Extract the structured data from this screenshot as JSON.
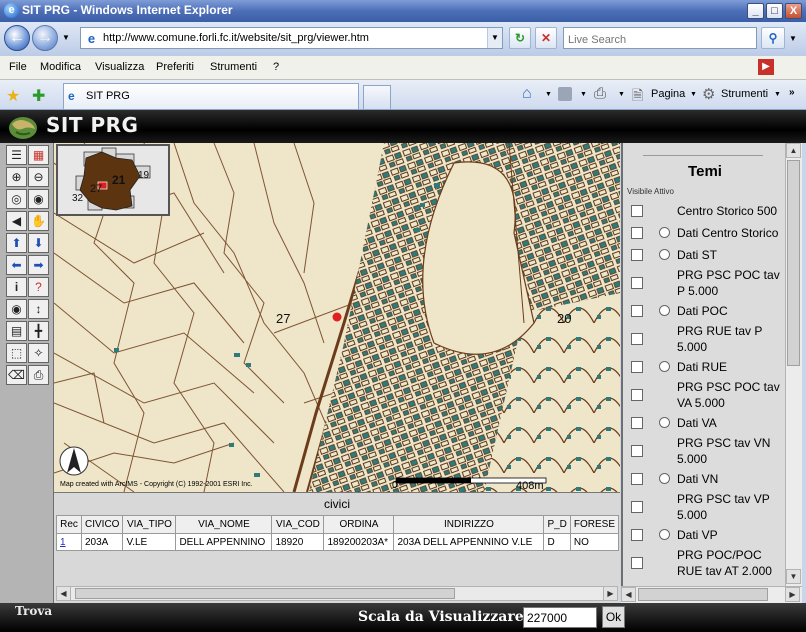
{
  "window": {
    "title": "SIT PRG - Windows Internet Explorer",
    "minimize": "_",
    "maximize": "□",
    "close": "X"
  },
  "address": {
    "url": "http://www.comune.forli.fc.it/website/sit_prg/viewer.htm",
    "search_placeholder": "Live Search"
  },
  "menu": [
    "File",
    "Modifica",
    "Visualizza",
    "Preferiti",
    "Strumenti",
    "?"
  ],
  "tab": {
    "label": "SIT PRG"
  },
  "commandbar": {
    "page": "Pagina",
    "tools": "Strumenti"
  },
  "app": {
    "title": "SIT PRG"
  },
  "map": {
    "overview_labels": [
      "21",
      "19",
      "27",
      "32"
    ],
    "labels": [
      "27",
      "20"
    ],
    "copyright": "Map created with ArcIMS - Copyright (C) 1992-2001 ESRI Inc.",
    "scalebar": {
      "start": "0",
      "end": "408m"
    }
  },
  "grid": {
    "title": "civici",
    "columns": [
      "Rec",
      "CIVICO",
      "VIA_TIPO",
      "VIA_NOME",
      "VIA_COD",
      "ORDINA",
      "INDIRIZZO",
      "P_D",
      "FORESE"
    ],
    "rows": [
      [
        "1",
        "203A",
        "V.LE",
        "DELL APPENNINO",
        "18920",
        "189200203A*",
        "203A DELL APPENNINO V.LE",
        "D",
        "NO"
      ]
    ]
  },
  "panel": {
    "title": "Temi",
    "header": "Visibile Attivo",
    "layers": [
      {
        "name": "Centro Storico 500",
        "radio": false
      },
      {
        "name": "Dati Centro Storico",
        "radio": true
      },
      {
        "name": "Dati ST",
        "radio": true
      },
      {
        "name": "PRG PSC POC tav P 5.000",
        "radio": false
      },
      {
        "name": "Dati POC",
        "radio": true
      },
      {
        "name": "PRG RUE tav P 5.000",
        "radio": false
      },
      {
        "name": "Dati RUE",
        "radio": true
      },
      {
        "name": "PRG PSC POC tav VA 5.000",
        "radio": false
      },
      {
        "name": "Dati VA",
        "radio": true
      },
      {
        "name": "PRG PSC tav VN 5.000",
        "radio": false
      },
      {
        "name": "Dati VN",
        "radio": true
      },
      {
        "name": "PRG PSC tav VP 5.000",
        "radio": false
      },
      {
        "name": "Dati VP",
        "radio": true
      },
      {
        "name": "PRG POC/POC RUE tav AT 2.000",
        "radio": false
      }
    ]
  },
  "bottom": {
    "find": "Trova",
    "scale_label": "Scala da Visualizzare 1 :",
    "scale_value": "227000",
    "ok": "Ok"
  }
}
